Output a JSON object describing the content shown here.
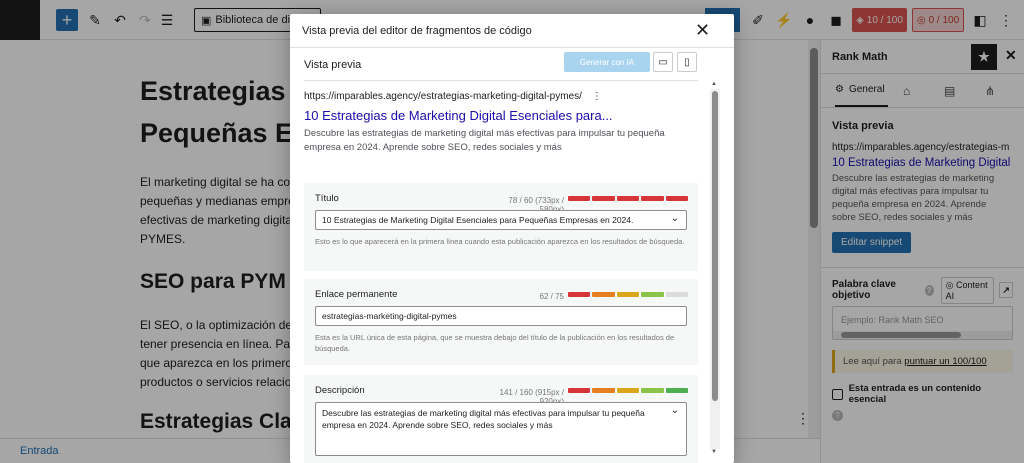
{
  "toolbar": {
    "library_label": "Biblioteca de diseño",
    "score_seo": "10 / 100",
    "score_readability": "0 / 100"
  },
  "editor": {
    "title_line1": "Estrategias",
    "title_line2": "Pequeñas E",
    "para1_lines": [
      "El marketing digital se ha co",
      "pequeñas y medianas empre",
      "efectivas de marketing digita",
      "PYMES."
    ],
    "heading2": "SEO para PYM",
    "para2_lines": [
      "El SEO, o la optimización de",
      "tener presencia en línea. Par",
      "que aparezca en los primero",
      "productos o servicios relacio"
    ],
    "heading3": "Estrategias Clav"
  },
  "footer": {
    "breadcrumb": "Entrada"
  },
  "sidebar": {
    "title": "Rank Math",
    "tab_general": "General",
    "preview_title": "Vista previa",
    "preview_url": "https://imparables.agency/estrategias-m",
    "preview_link": "10 Estrategias de Marketing Digital E",
    "preview_desc": "Descubre las estrategias de marketing digital más efectivas para impulsar tu pequeña empresa en 2024. Aprende sobre SEO, redes sociales y más",
    "edit_snippet": "Editar snippet",
    "keyword_label": "Palabra clave objetivo",
    "content_ai": "Content AI",
    "keyword_placeholder": "Ejemplo: Rank Math SEO",
    "note_prefix": "Lee aquí para ",
    "note_link": "puntuar un 100/100",
    "pillar_label": "Esta entrada es un contenido esencial"
  },
  "modal": {
    "title": "Vista previa del editor de fragmentos de código",
    "preview_label": "Vista previa",
    "generate_button": "Generar con IA",
    "serp_url": "https://imparables.agency/estrategias-marketing-digital-pymes/",
    "serp_title": "10 Estrategias de Marketing Digital Esenciales para...",
    "serp_desc": "Descubre las estrategias de marketing digital más efectivas para impulsar tu pequeña empresa en 2024. Aprende sobre SEO, redes sociales y más",
    "title_field": {
      "label": "Título",
      "count": "78 / 60 (733px / 580px)",
      "value": "10 Estrategias de Marketing Digital Esenciales para Pequeñas Empresas en 2024.",
      "help": "Esto es lo que aparecerá en la primera línea cuando esta publicación aparezca en los resultados de búsqueda."
    },
    "permalink_field": {
      "label": "Enlace permanente",
      "count": "62 / 75",
      "value": "estrategias-marketing-digital-pymes",
      "help": "Esta es la URL única de esta página, que se muestra debajo del título de la publicación en los resultados de búsqueda."
    },
    "description_field": {
      "label": "Descripción",
      "count": "141 / 160 (915px / 920px)",
      "value": "Descubre las estrategias de marketing digital más efectivas para impulsar tu pequeña empresa en 2024. Aprende sobre SEO, redes sociales y más"
    }
  },
  "colors": {
    "accent": "#2271b1",
    "serp_link": "#1a0dab",
    "bar_red": "#d63638",
    "bar_orange": "#e67e22",
    "bar_yellow": "#dba617",
    "bar_green": "#4caf50",
    "bar_empty": "#dcdcde"
  }
}
